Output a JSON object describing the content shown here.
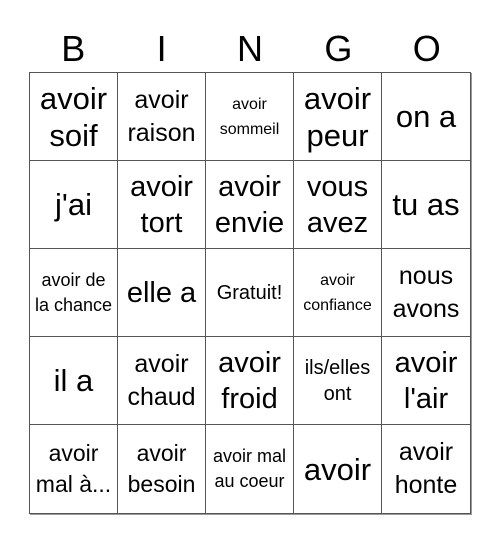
{
  "header": {
    "letters": [
      "B",
      "I",
      "N",
      "G",
      "O"
    ]
  },
  "cells": [
    {
      "text": "avoir soif",
      "size": "s-xl"
    },
    {
      "text": "avoir raison",
      "size": "s-m"
    },
    {
      "text": "avoir sommeil",
      "size": "s-xs"
    },
    {
      "text": "avoir peur",
      "size": "s-xl"
    },
    {
      "text": "on a",
      "size": "s-xl"
    },
    {
      "text": "j'ai",
      "size": "s-xl"
    },
    {
      "text": "avoir tort",
      "size": "s-l"
    },
    {
      "text": "avoir envie",
      "size": "s-l"
    },
    {
      "text": "vous avez",
      "size": "s-l"
    },
    {
      "text": "tu as",
      "size": "s-xl"
    },
    {
      "text": "avoir de la chance",
      "size": "s-s"
    },
    {
      "text": "elle a",
      "size": "s-l"
    },
    {
      "text": "Gratuit!",
      "size": "s-sm"
    },
    {
      "text": "avoir confiance",
      "size": "s-xs"
    },
    {
      "text": "nous avons",
      "size": "s-m"
    },
    {
      "text": "il a",
      "size": "s-xl"
    },
    {
      "text": "avoir chaud",
      "size": "s-m"
    },
    {
      "text": "avoir froid",
      "size": "s-l"
    },
    {
      "text": "ils/elles ont",
      "size": "s-sm"
    },
    {
      "text": "avoir l'air",
      "size": "s-l"
    },
    {
      "text": "avoir mal à...",
      "size": "s-ms"
    },
    {
      "text": "avoir besoin",
      "size": "s-ms"
    },
    {
      "text": "avoir mal au coeur",
      "size": "s-s"
    },
    {
      "text": "avoir",
      "size": "s-xl"
    },
    {
      "text": "avoir honte",
      "size": "s-m"
    }
  ],
  "free_space_index": 12
}
